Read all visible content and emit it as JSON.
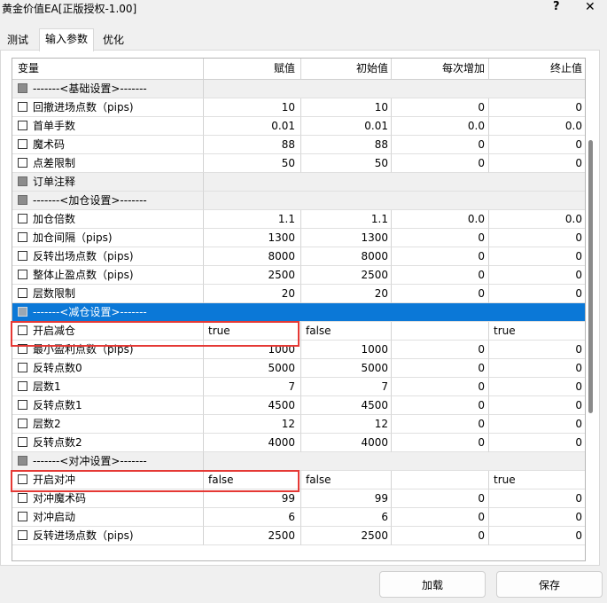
{
  "window": {
    "title": "黄金价值EA[正版授权-1.00]",
    "help_label": "?",
    "close_label": "✕"
  },
  "tabs": [
    {
      "label": "测试"
    },
    {
      "label": "输入参数",
      "active": true
    },
    {
      "label": "优化"
    }
  ],
  "grid": {
    "columns": [
      "变量",
      "赋值",
      "初始值",
      "每次增加",
      "终止值"
    ],
    "rows": [
      {
        "type": "section",
        "name": "-------<基础设置>-------"
      },
      {
        "type": "param",
        "name": "回撤进场点数（pips)",
        "value": "10",
        "start": "10",
        "step": "0",
        "stop": "0"
      },
      {
        "type": "param",
        "name": "首单手数",
        "value": "0.01",
        "start": "0.01",
        "step": "0.0",
        "stop": "0.0"
      },
      {
        "type": "param",
        "name": "魔术码",
        "value": "88",
        "start": "88",
        "step": "0",
        "stop": "0"
      },
      {
        "type": "param",
        "name": "点差限制",
        "value": "50",
        "start": "50",
        "step": "0",
        "stop": "0"
      },
      {
        "type": "section",
        "name": "订单注释"
      },
      {
        "type": "section",
        "name": "-------<加仓设置>-------"
      },
      {
        "type": "param",
        "name": "加仓倍数",
        "value": "1.1",
        "start": "1.1",
        "step": "0.0",
        "stop": "0.0"
      },
      {
        "type": "param",
        "name": "加仓间隔（pips)",
        "value": "1300",
        "start": "1300",
        "step": "0",
        "stop": "0"
      },
      {
        "type": "param",
        "name": "反转出场点数（pips)",
        "value": "8000",
        "start": "8000",
        "step": "0",
        "stop": "0"
      },
      {
        "type": "param",
        "name": "整体止盈点数（pips)",
        "value": "2500",
        "start": "2500",
        "step": "0",
        "stop": "0"
      },
      {
        "type": "param",
        "name": "层数限制",
        "value": "20",
        "start": "20",
        "step": "0",
        "stop": "0"
      },
      {
        "type": "section",
        "name": "-------<减仓设置>-------",
        "selected": true
      },
      {
        "type": "bool",
        "name": "开启减仓",
        "value": "true",
        "start": "false",
        "step": "",
        "stop": "true"
      },
      {
        "type": "param",
        "name": "最小盈利点数（pips)",
        "value": "1000",
        "start": "1000",
        "step": "0",
        "stop": "0"
      },
      {
        "type": "param",
        "name": "反转点数0",
        "value": "5000",
        "start": "5000",
        "step": "0",
        "stop": "0"
      },
      {
        "type": "param",
        "name": "层数1",
        "value": "7",
        "start": "7",
        "step": "0",
        "stop": "0"
      },
      {
        "type": "param",
        "name": "反转点数1",
        "value": "4500",
        "start": "4500",
        "step": "0",
        "stop": "0"
      },
      {
        "type": "param",
        "name": "层数2",
        "value": "12",
        "start": "12",
        "step": "0",
        "stop": "0"
      },
      {
        "type": "param",
        "name": "反转点数2",
        "value": "4000",
        "start": "4000",
        "step": "0",
        "stop": "0"
      },
      {
        "type": "section",
        "name": "-------<对冲设置>-------"
      },
      {
        "type": "bool",
        "name": "开启对冲",
        "value": "false",
        "start": "false",
        "step": "",
        "stop": "true"
      },
      {
        "type": "param",
        "name": "对冲魔术码",
        "value": "99",
        "start": "99",
        "step": "0",
        "stop": "0"
      },
      {
        "type": "param",
        "name": "对冲启动",
        "value": "6",
        "start": "6",
        "step": "0",
        "stop": "0"
      },
      {
        "type": "param",
        "name": "反转进场点数（pips)",
        "value": "2500",
        "start": "2500",
        "step": "0",
        "stop": "0"
      }
    ]
  },
  "buttons": {
    "load": "加载",
    "save": "保存"
  },
  "colors": {
    "selection": "#0b78d7",
    "highlight_border": "#e53935"
  }
}
